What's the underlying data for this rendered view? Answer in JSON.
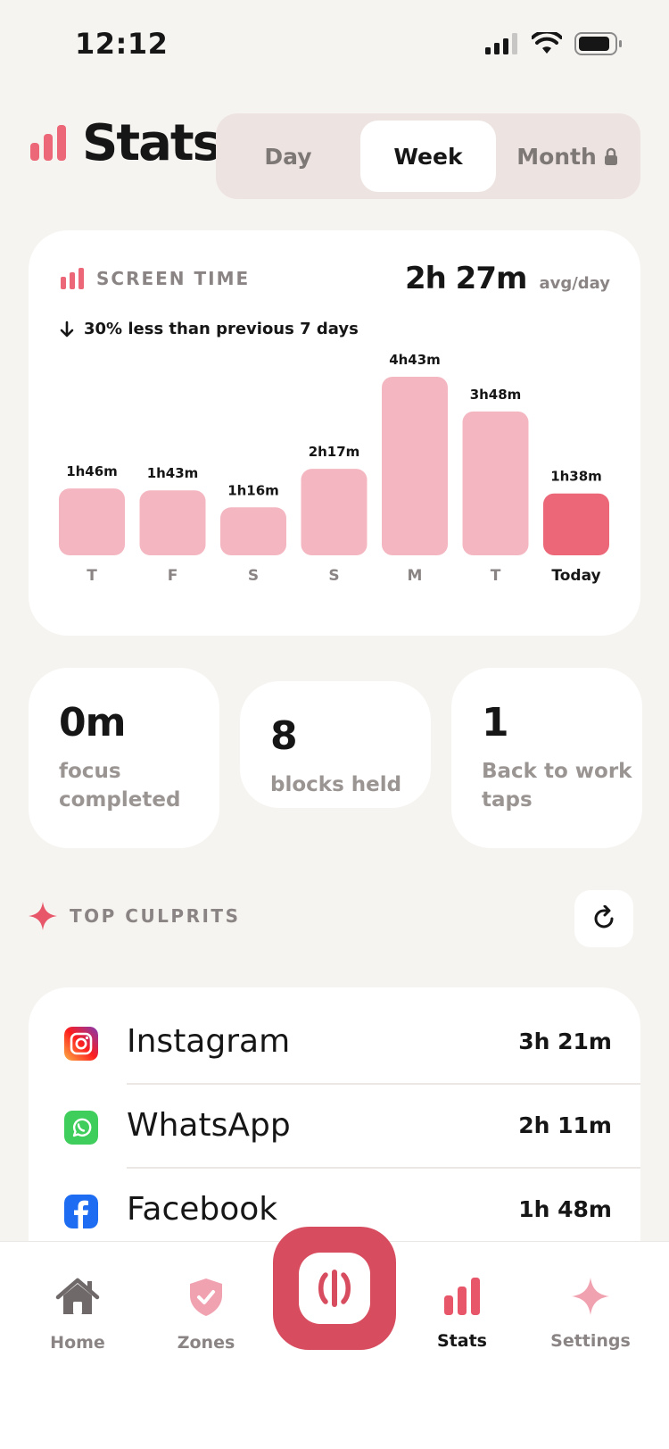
{
  "status_bar": {
    "time": "12:12"
  },
  "header": {
    "title": "Stats"
  },
  "segmented": {
    "day": "Day",
    "week": "Week",
    "month": "Month",
    "selected": "Week"
  },
  "screen_time": {
    "label": "SCREEN TIME",
    "avg": "2h 27m",
    "avg_unit": "avg/day",
    "compare": "30% less than previous 7 days"
  },
  "chart_data": {
    "type": "bar",
    "categories": [
      "T",
      "F",
      "S",
      "S",
      "M",
      "T",
      "Today"
    ],
    "values": [
      106,
      103,
      76,
      137,
      283,
      228,
      98
    ],
    "value_labels": [
      "1h46m",
      "1h43m",
      "1h16m",
      "2h17m",
      "4h43m",
      "3h48m",
      "1h38m"
    ],
    "highlight_index": 6,
    "colors": {
      "bar": "#f4b7c1",
      "highlight": "#ec6878"
    }
  },
  "tiles": [
    {
      "number": "0m",
      "text": "focus completed"
    },
    {
      "number": "8",
      "text": "blocks held"
    },
    {
      "number": "1",
      "text": "Back to work taps"
    }
  ],
  "culprits": {
    "title": "TOP CULPRITS",
    "apps": [
      {
        "name": "Instagram",
        "time": "3h 21m",
        "icon": "instagram-icon"
      },
      {
        "name": "WhatsApp",
        "time": "2h 11m",
        "icon": "whatsapp-icon"
      },
      {
        "name": "Facebook",
        "time": "1h 48m",
        "icon": "facebook-icon"
      }
    ]
  },
  "tabs": {
    "home": "Home",
    "zones": "Zones",
    "stats": "Stats",
    "settings": "Settings",
    "active": "Stats"
  },
  "colors": {
    "accent": "#d74c5e",
    "pink": "#ec6878",
    "background": "#f6f4f1"
  }
}
